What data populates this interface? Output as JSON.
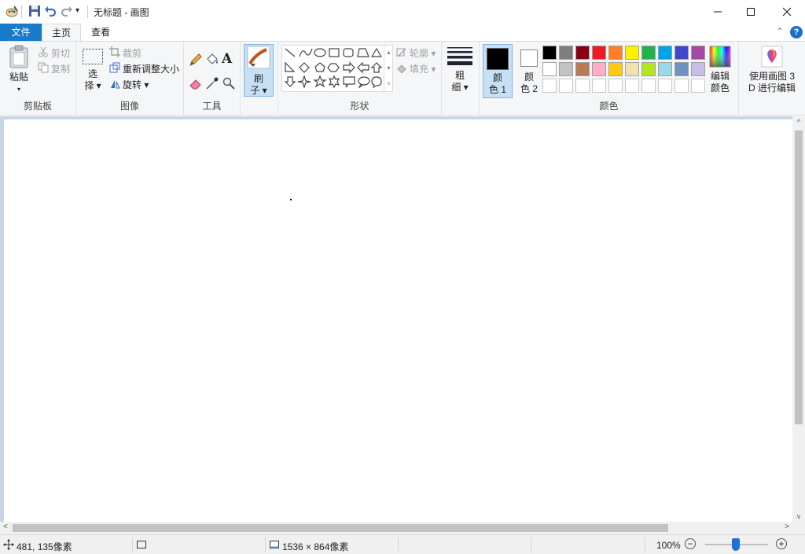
{
  "window": {
    "title": "无标题 - 画图",
    "minimize_icon": "minimize-icon",
    "maximize_icon": "maximize-icon",
    "close_icon": "close-icon"
  },
  "quick_access": {
    "qa_dropdown": "▾"
  },
  "tabs": {
    "file": "文件",
    "home": "主页",
    "view": "查看",
    "collapse": "⌃",
    "help": "?"
  },
  "clipboard": {
    "paste_line1": "粘贴",
    "paste_line2": "▾",
    "cut": "剪切",
    "copy": "复制",
    "group": "剪贴板"
  },
  "image": {
    "select_line1": "选",
    "select_line2": "择 ▾",
    "crop": "裁剪",
    "resize": "重新调整大小",
    "rotate": "旋转 ▾",
    "group": "图像"
  },
  "tools": {
    "group": "工具",
    "text_glyph": "A"
  },
  "brushes": {
    "line1": "刷",
    "line2": "子 ▾"
  },
  "shapes": {
    "outline": "轮廓 ▾",
    "fill": "填充 ▾",
    "group": "形状"
  },
  "size": {
    "line1": "粗",
    "line2": "细 ▾"
  },
  "colors": {
    "color1_line1": "颜",
    "color1_line2": "色 1",
    "color2_line1": "颜",
    "color2_line2": "色 2",
    "edit_line1": "编辑",
    "edit_line2": "颜色",
    "paint3d_line1": "使用画图 3",
    "paint3d_line2": "D 进行编辑",
    "group": "颜色",
    "color1_value": "#000000",
    "color2_value": "#ffffff",
    "palette_row1": [
      "#000000",
      "#7f7f7f",
      "#880015",
      "#ed1c24",
      "#ff7f27",
      "#fff200",
      "#22b14c",
      "#00a2e8",
      "#3f48cc",
      "#a349a4"
    ],
    "palette_row2": [
      "#ffffff",
      "#c3c3c3",
      "#b97a57",
      "#ffaec9",
      "#ffc90e",
      "#efe4b0",
      "#b5e61d",
      "#99d9ea",
      "#7092be",
      "#c8bfe7"
    ]
  },
  "status": {
    "cursor_pos": "481, 135像素",
    "canvas_size": "1536 × 864像素",
    "zoom": "100%",
    "zoom_out": "−",
    "zoom_in": "+"
  },
  "scroll": {
    "up": "^",
    "down": "v",
    "left": "<",
    "right": ">"
  }
}
